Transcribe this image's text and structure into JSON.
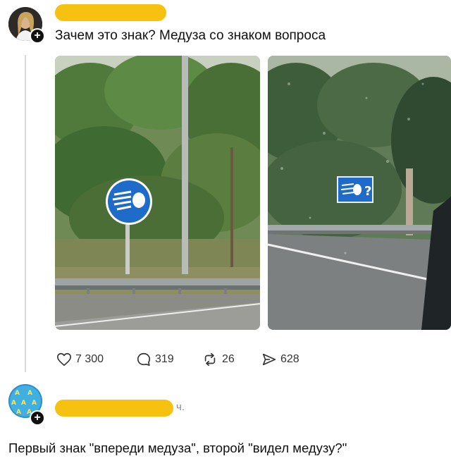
{
  "post": {
    "text": "Зачем это знак? Медуза со знаком вопроса",
    "images": [
      {
        "name": "sign-photo-clear"
      },
      {
        "name": "sign-photo-question"
      }
    ],
    "actions": {
      "likes": "7 300",
      "replies": "319",
      "reposts": "26",
      "shares": "628"
    }
  },
  "reply": {
    "time_suffix": "ч.",
    "text": "Первый знак \"впереди медуза\", второй \"видел медузу?\""
  },
  "colors": {
    "redaction": "#f6c20f",
    "sign_blue": "#1e6bc9"
  },
  "icons": {
    "like": "heart-icon",
    "reply": "comment-icon",
    "repost": "repost-icon",
    "share": "share-icon",
    "follow": "plus-icon"
  }
}
